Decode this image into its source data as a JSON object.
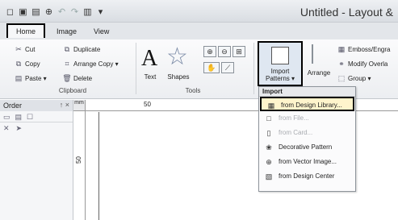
{
  "window": {
    "title": "Untitled - Layout &"
  },
  "quick_access": {
    "icons": [
      "new-icon",
      "open-icon",
      "save-icon",
      "zoom-icon",
      "undo-icon",
      "redo-icon",
      "preview-icon",
      "dropdown-icon"
    ],
    "glyphs": [
      "◻",
      "▣",
      "▤",
      "⊕",
      "↶",
      "↷",
      "▥",
      "▾"
    ]
  },
  "tabs": [
    {
      "label": "Home",
      "active": true
    },
    {
      "label": "Image",
      "active": false
    },
    {
      "label": "View",
      "active": false
    }
  ],
  "ribbon": {
    "clipboard": {
      "label": "Clipboard",
      "cut": "Cut",
      "copy": "Copy",
      "paste": "Paste ▾",
      "duplicate": "Duplicate",
      "arrange_copy": "Arrange Copy ▾",
      "delete": "Delete"
    },
    "tools": {
      "label": "Tools",
      "text": "Text",
      "shapes": "Shapes",
      "text_glyph": "A",
      "shapes_glyph": "☆"
    },
    "import": {
      "label": "Import",
      "button_line1": "Import",
      "button_line2": "Patterns ▾"
    },
    "arrange": {
      "arrange": "Arrange",
      "emboss": "Emboss/Engra",
      "modify": "Modify Overla",
      "group": "Group ▾"
    }
  },
  "order_pane": {
    "title": "Order",
    "pin": "↑ ×"
  },
  "rulers": {
    "h_mark": "50",
    "v_mark": "50",
    "corner": "mm"
  },
  "dropdown": {
    "heading": "Import",
    "items": [
      {
        "label": "from Design Library...",
        "icon": "design-library-icon",
        "glyph": "▦",
        "disabled": false,
        "highlight": true
      },
      {
        "label": "from File...",
        "icon": "file-icon",
        "glyph": "□",
        "disabled": true,
        "highlight": false
      },
      {
        "label": "from Card...",
        "icon": "card-icon",
        "glyph": "▯",
        "disabled": true,
        "highlight": false
      },
      {
        "label": "Decorative Pattern",
        "icon": "decorative-pattern-icon",
        "glyph": "❀",
        "disabled": false,
        "highlight": false
      },
      {
        "label": "from Vector Image...",
        "icon": "vector-image-icon",
        "glyph": "⊕",
        "disabled": false,
        "highlight": false
      },
      {
        "label": "from Design Center",
        "icon": "design-center-icon",
        "glyph": "▧",
        "disabled": false,
        "highlight": false
      }
    ]
  }
}
